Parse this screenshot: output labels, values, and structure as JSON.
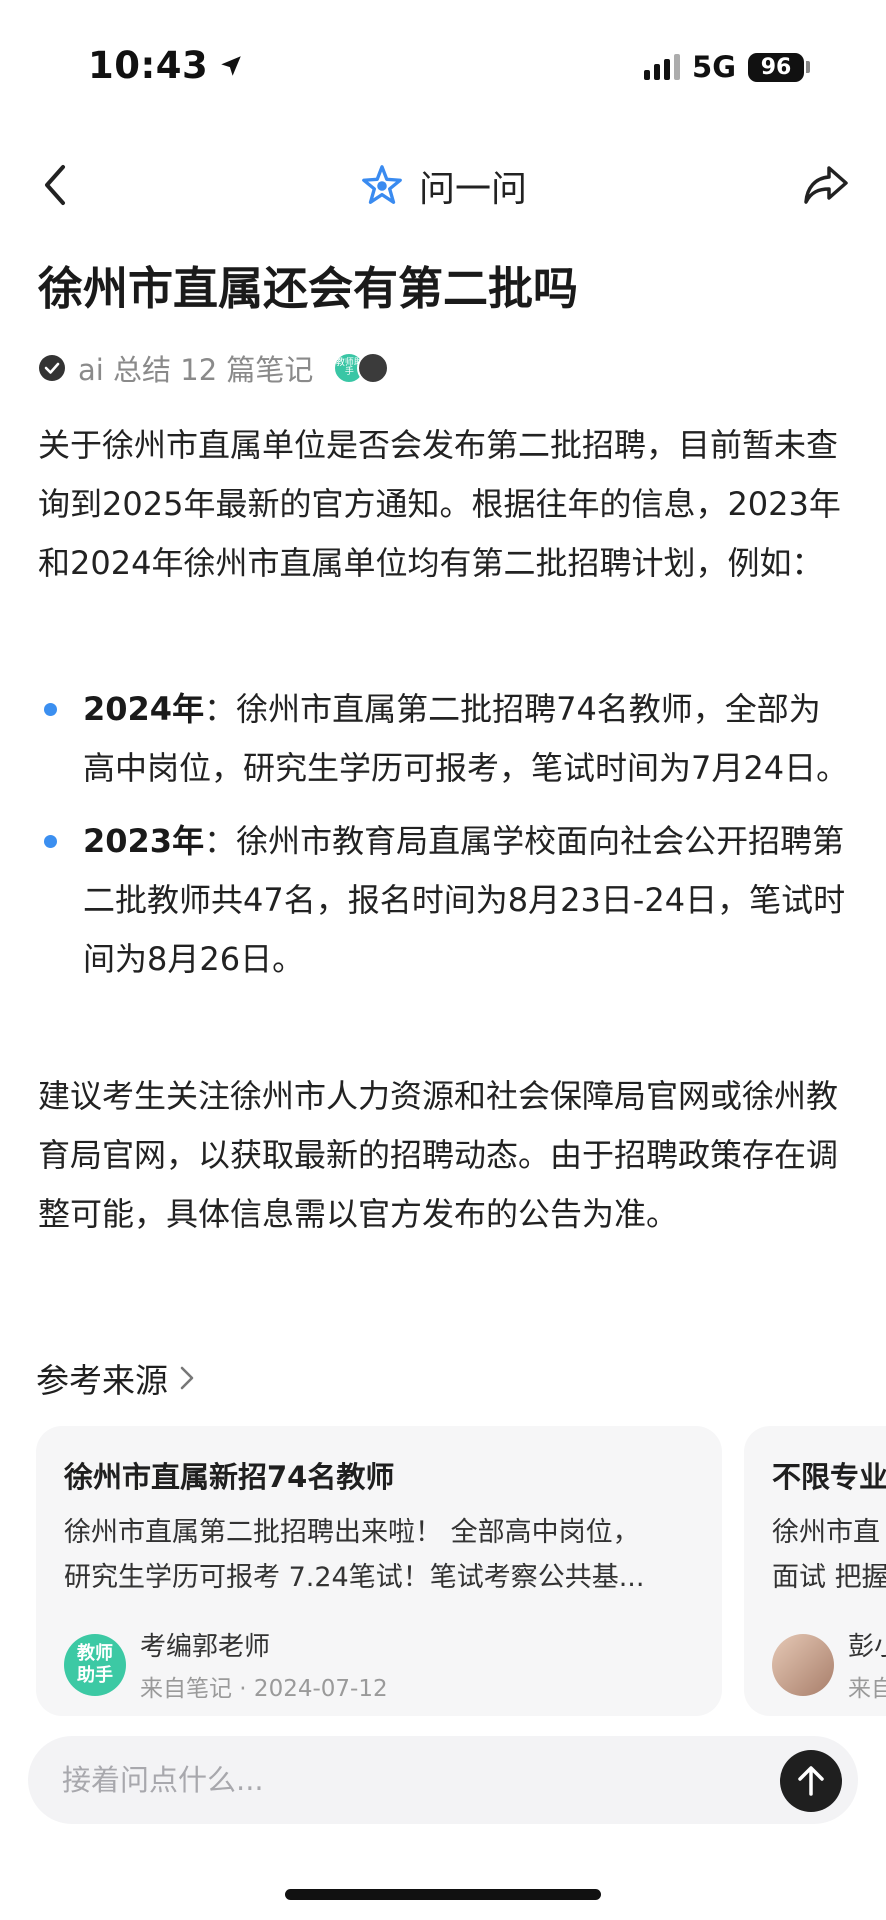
{
  "status_bar": {
    "time": "10:43",
    "network": "5G",
    "battery": "96"
  },
  "nav": {
    "title": "问一问",
    "back_icon": "chevron-left-icon",
    "share_icon": "share-icon",
    "logo_icon": "star-logo-icon"
  },
  "question": {
    "title": "徐州市直属还会有第二批吗"
  },
  "summary_meta": {
    "text": "ai 总结 12 篇笔记",
    "avatar_1_text": "教师助手"
  },
  "answer": {
    "intro": "关于徐州市直属单位是否会发布第二批招聘，目前暂未查询到2025年最新的官方通知。根据往年的信息，2023年和2024年徐州市直属单位均有第二批招聘计划，例如：",
    "bullets": [
      {
        "label": "2024年",
        "text": "：徐州市直属第二批招聘74名教师，全部为高中岗位，研究生学历可报考，笔试时间为7月24日。"
      },
      {
        "label": "2023年",
        "text": "：徐州市教育局直属学校面向社会公开招聘第二批教师共47名，报名时间为8月23日-24日，笔试时间为8月26日。"
      }
    ],
    "conclusion": "建议考生关注徐州市人力资源和社会保障局官网或徐州教育局官网，以获取最新的招聘动态。由于招聘政策存在调整可能，具体信息需以官方发布的公告为准。"
  },
  "references": {
    "header": "参考来源",
    "cards": [
      {
        "title": "徐州市直属新招74名教师",
        "excerpt_line1": "徐州市直属第二批招聘出来啦！ 全部高中岗位，",
        "excerpt_line2": "研究生学历可报考 7.24笔试！笔试考察公共基...",
        "avatar_text_1": "教师",
        "avatar_text_2": "助手",
        "author": "考编郭老师",
        "source": "来自笔记 · 2024-07-12"
      },
      {
        "title": "不限专业",
        "excerpt_line1": "徐州市直",
        "excerpt_line2": "面试 把握",
        "author": "彭小",
        "source": "来自"
      }
    ]
  },
  "input": {
    "placeholder": "接着问点什么..."
  },
  "colors": {
    "bullet_dot": "#3b8ff0",
    "send_button": "#1f1f1f",
    "card_bg": "#f6f6f7",
    "brand_logo": "#3a8bf0"
  }
}
